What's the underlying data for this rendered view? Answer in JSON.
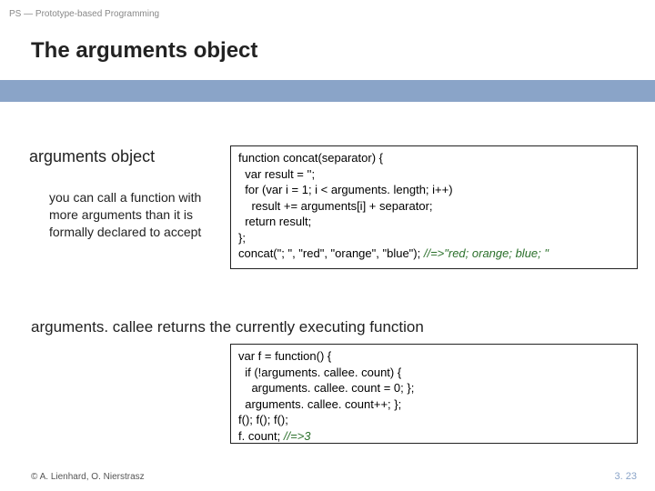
{
  "header": {
    "breadcrumb": "PS — Prototype-based Programming"
  },
  "title": "The arguments object",
  "section1": {
    "heading": "arguments object",
    "desc": "you can call a function with more arguments than it is formally declared to accept"
  },
  "code1": {
    "l1": "function concat(separator) {",
    "l2": "  var result = '';",
    "l3": "  for (var i = 1; i < arguments. length; i++)",
    "l4": "    result += arguments[i] + separator;",
    "l5": "  return result;",
    "l6": "};",
    "l7a": "concat(\"; \", \"red\", \"orange\", \"blue\"); ",
    "l7b": "//=>\"red; orange; blue; \""
  },
  "section2": {
    "line": "arguments. callee returns the currently executing function"
  },
  "code2": {
    "l1": "var f = function() {",
    "l2": "  if (!arguments. callee. count) {",
    "l3": "    arguments. callee. count = 0; };",
    "l4": "  arguments. callee. count++; };",
    "l5": "f(); f(); f();",
    "l6a": "f. count; ",
    "l6b": "//=>3"
  },
  "footer": {
    "left": "© A. Lienhard, O. Nierstrasz",
    "right": "3. 23"
  }
}
